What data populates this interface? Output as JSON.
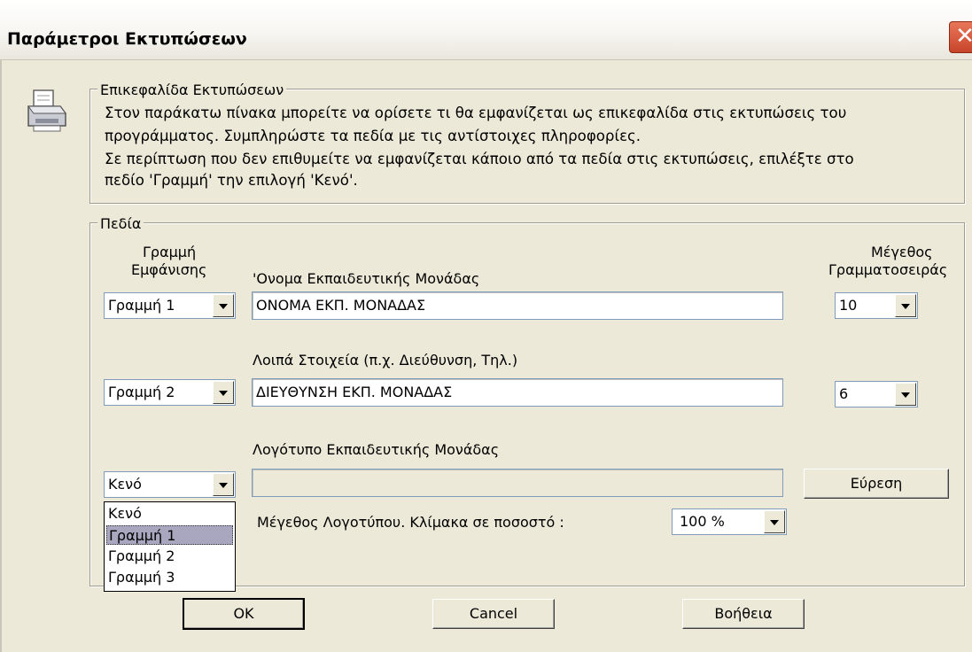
{
  "window": {
    "title": "Παράμετροι Εκτυπώσεων",
    "close_glyph": "✕"
  },
  "header_group": {
    "legend": "Επικεφαλίδα Εκτυπώσεων",
    "lines": [
      "Στον παράκατω πίνακα μπορείτε να ορίσετε τι θα εμφανίζεται ως επικεφαλίδα στις εκτυπώσεις του",
      "προγράμματος. Συμπληρώστε τα πεδία με τις αντίστοιχες πληροφορίες.",
      "Σε περίπτωση που δεν επιθυμείτε να εμφανίζεται κάποιο από τα πεδία στις εκτυπώσεις, επιλέξτε στο",
      "πεδίο 'Γραμμή' την επιλογή 'Κενό'."
    ]
  },
  "fields_group": {
    "legend": "Πεδία",
    "col_line_1": "Γραμμή",
    "col_line_2": "Εμφάνισης",
    "col_size_1": "Μέγεθος",
    "col_size_2": "Γραμματοσειράς",
    "name_label": "'Ονομα Εκπαιδευτικής Μονάδας",
    "name_line": "Γραμμή 1",
    "name_value": "ΟΝΟΜΑ ΕΚΠ. ΜΟΝΑΔΑΣ",
    "name_size": "10",
    "other_label": "Λοιπά Στοιχεία (π.χ.  Διεύθυνση, Τηλ.)",
    "other_line": "Γραμμή 2",
    "other_value": "ΔΙΕΥΘΥΝΣΗ ΕΚΠ. ΜΟΝΑΔΑΣ",
    "other_size": "6",
    "logo_label": "Λογότυπο Εκπαιδευτικής Μονάδας",
    "logo_line": "Κενό",
    "logo_value": "",
    "browse_label": "Εύρεση",
    "logo_scale_label": "Μέγεθος Λογοτύπου. Κλίμακα σε ποσοστό :",
    "logo_scale_value": "100 %",
    "dropdown_options": [
      "Κενό",
      "Γραμμή 1",
      "Γραμμή 2",
      "Γραμμή 3"
    ]
  },
  "buttons": {
    "ok": "OK",
    "cancel": "Cancel",
    "help": "Βοήθεια"
  }
}
